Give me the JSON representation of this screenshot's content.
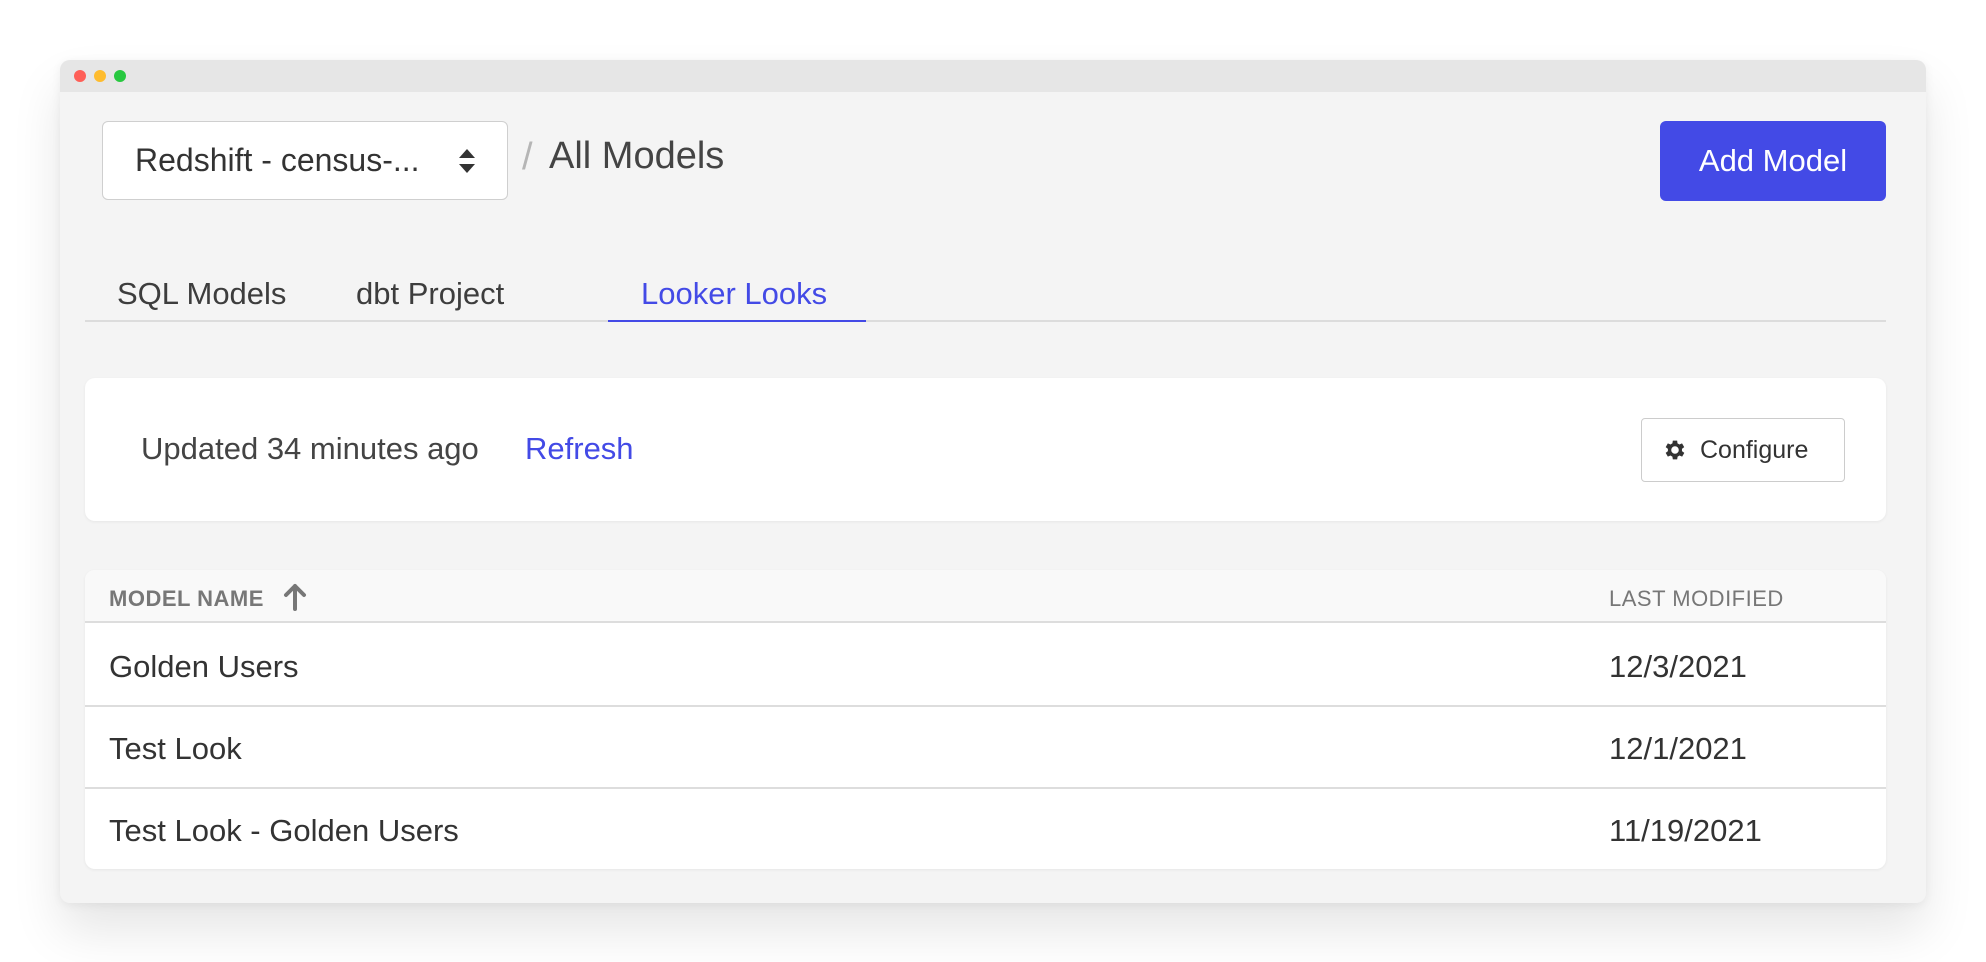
{
  "header": {
    "source_select_value": "Redshift - census-...",
    "breadcrumb_separator": "/",
    "title": "All Models",
    "add_model_label": "Add Model"
  },
  "tabs": [
    {
      "label": "SQL Models",
      "active": false
    },
    {
      "label": "dbt Project",
      "active": false
    },
    {
      "label": "Looker Looks",
      "active": true
    }
  ],
  "status": {
    "updated_text": "Updated 34 minutes ago",
    "refresh_label": "Refresh",
    "configure_label": "Configure"
  },
  "table": {
    "columns": {
      "name": "MODEL NAME",
      "modified": "LAST MODIFIED"
    },
    "sort": {
      "column": "name",
      "direction": "ascending",
      "icon": "arrow-up-icon"
    },
    "rows": [
      {
        "name": "Golden Users",
        "modified": "12/3/2021"
      },
      {
        "name": "Test Look",
        "modified": "12/1/2021"
      },
      {
        "name": "Test Look - Golden Users",
        "modified": "11/19/2021"
      }
    ]
  },
  "colors": {
    "accent": "#434ae6",
    "background": "#f4f4f4",
    "card": "#ffffff"
  },
  "icons": {
    "select": "select-arrows-icon",
    "configure": "gear-icon",
    "sort": "arrow-up-icon"
  }
}
